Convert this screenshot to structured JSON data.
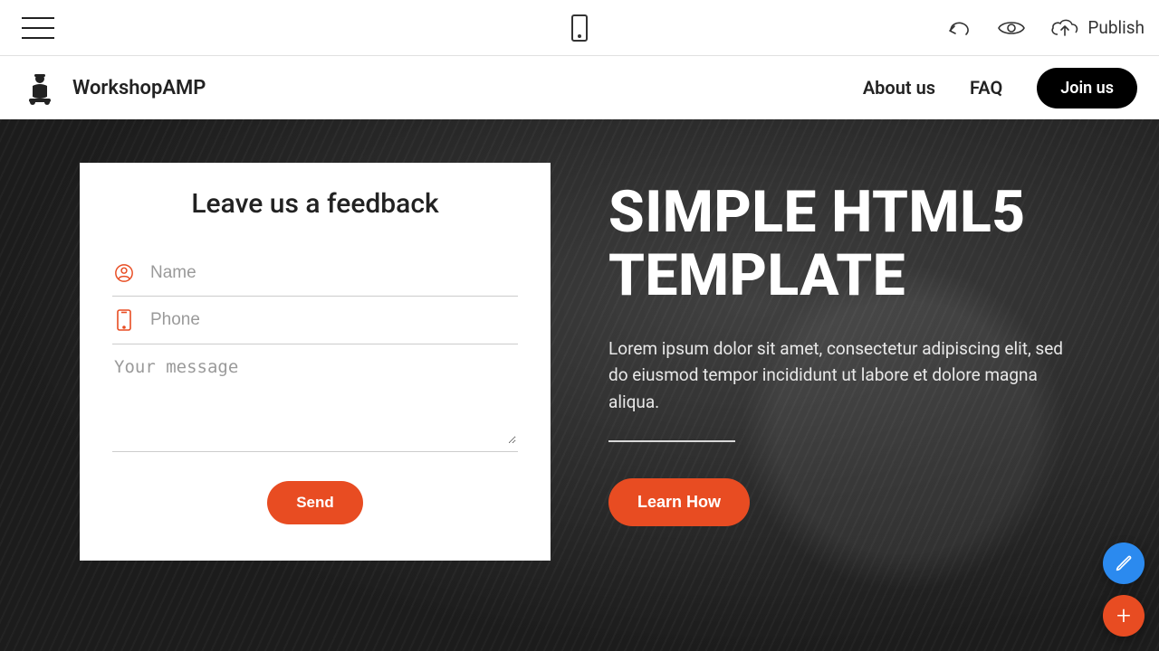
{
  "editor": {
    "publish_label": "Publish"
  },
  "site": {
    "brand_name": "WorkshopAMP",
    "nav": {
      "about": "About us",
      "faq": "FAQ",
      "join": "Join us"
    }
  },
  "hero": {
    "title": "SIMPLE HTML5 TEMPLATE",
    "body": "Lorem ipsum dolor sit amet, consectetur adipiscing elit, sed do eiusmod tempor incididunt ut labore et dolore magna aliqua.",
    "learn_btn": "Learn How"
  },
  "feedback": {
    "title": "Leave us a feedback",
    "name_placeholder": "Name",
    "phone_placeholder": "Phone",
    "message_placeholder": "Your message",
    "send_btn": "Send"
  },
  "colors": {
    "accent": "#e84c22",
    "float_blue": "#2b8aef"
  }
}
